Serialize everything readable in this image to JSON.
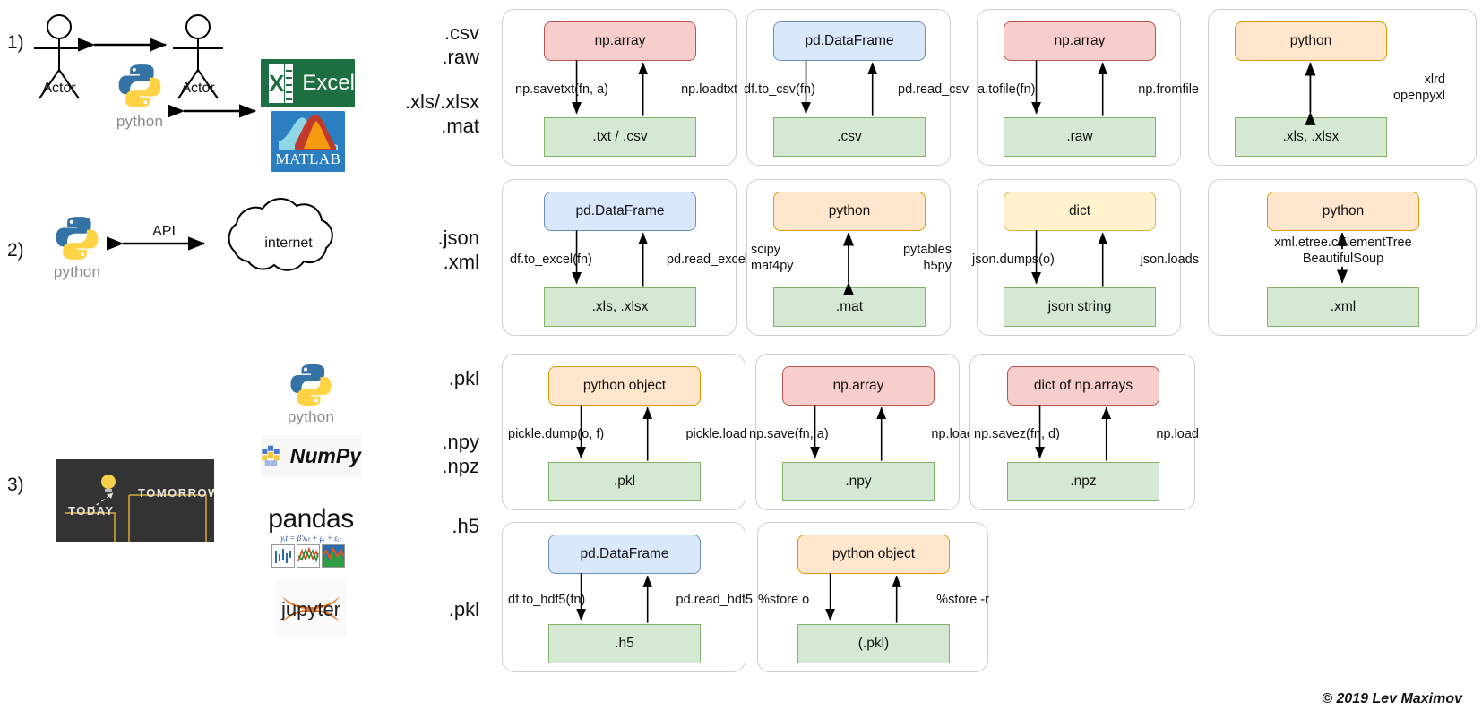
{
  "rows": [
    {
      "number": "1)"
    },
    {
      "number": "2)"
    },
    {
      "number": "3)"
    }
  ],
  "illustrations": {
    "actor_left_label": "Actor",
    "actor_right_label": "Actor",
    "python_label_1": "python",
    "python_label_2": "python",
    "python_label_3": "python",
    "excel_label": "Excel",
    "excel_x": "X",
    "matlab_label": "MATLAB",
    "api_label": "API",
    "internet_label": "internet",
    "numpy_label": "NumPy",
    "pandas_label": "pandas",
    "pandas_formula": "yᵢt = β'xᵢₜ + μᵢ + εᵢₜ",
    "jupyter_label": "jupyter",
    "chalkboard_today": "TODAY",
    "chalkboard_tomorrow": "TOMORROW"
  },
  "extensions": [
    {
      "text": ".csv\n.raw"
    },
    {
      "text": ".xls/.xlsx\n.mat"
    },
    {
      "text": ".json\n.xml"
    },
    {
      "text": ".pkl"
    },
    {
      "text": ".npy\n.npz"
    },
    {
      "text": ".h5"
    },
    {
      "text": ".pkl"
    }
  ],
  "colors": {
    "red_fill": "#f8cecc",
    "red_border": "#b85450",
    "blue_fill": "#dae8fc",
    "blue_border": "#6c8ebf",
    "orange_fill": "#ffe6cc",
    "orange_border": "#d79b00",
    "yellow_fill": "#fff2cc",
    "yellow_border": "#d6b656",
    "green_fill": "#d5e8d4",
    "green_border": "#82b366",
    "card_border": "#cfcfcf"
  },
  "cards": [
    {
      "id": "csv-numpy",
      "top": {
        "label": "np.array",
        "style": "red"
      },
      "bottom": {
        "label": ".txt / .csv",
        "style": "green"
      },
      "left_label": "np.savetxt(fn, a)",
      "right_label": "np.loadtxt",
      "arrows": "both"
    },
    {
      "id": "csv-pandas",
      "top": {
        "label": "pd.DataFrame",
        "style": "blue"
      },
      "bottom": {
        "label": ".csv",
        "style": "green"
      },
      "left_label": "df.to_csv(fn)",
      "right_label": "pd.read_csv",
      "arrows": "both"
    },
    {
      "id": "raw-numpy",
      "top": {
        "label": "np.array",
        "style": "red"
      },
      "bottom": {
        "label": ".raw",
        "style": "green"
      },
      "left_label": "a.tofile(fn)",
      "right_label": "np.fromfile",
      "arrows": "both"
    },
    {
      "id": "xls-python",
      "top": {
        "label": "python",
        "style": "orange"
      },
      "bottom": {
        "label": ".xls, .xlsx",
        "style": "green"
      },
      "right_label": "xlrd\nopenpyxl",
      "arrows": "double"
    },
    {
      "id": "xls-pandas",
      "top": {
        "label": "pd.DataFrame",
        "style": "blue"
      },
      "bottom": {
        "label": ".xls, .xlsx",
        "style": "green"
      },
      "left_label": "df.to_excel(fn)",
      "right_label": "pd.read_excel",
      "arrows": "both"
    },
    {
      "id": "mat-python",
      "top": {
        "label": "python",
        "style": "orange"
      },
      "bottom": {
        "label": ".mat",
        "style": "green"
      },
      "left_label": "scipy\nmat4py",
      "right_label": "pytables\nh5py",
      "arrows": "double"
    },
    {
      "id": "json-dict",
      "top": {
        "label": "dict",
        "style": "yellow"
      },
      "bottom": {
        "label": "json string",
        "style": "green"
      },
      "left_label": "json.dumps(o)",
      "right_label": "json.loads",
      "arrows": "both"
    },
    {
      "id": "xml-python",
      "top": {
        "label": "python",
        "style": "orange"
      },
      "bottom": {
        "label": ".xml",
        "style": "green"
      },
      "center_label": "xml.etree.cElementTree\nBeautifulSoup",
      "arrows": "double-center"
    },
    {
      "id": "pkl-python",
      "top": {
        "label": "python object",
        "style": "orange"
      },
      "bottom": {
        "label": ".pkl",
        "style": "green"
      },
      "left_label": "pickle.dump(o, f)",
      "right_label": "pickle.load",
      "arrows": "both"
    },
    {
      "id": "npy-numpy",
      "top": {
        "label": "np.array",
        "style": "red"
      },
      "bottom": {
        "label": ".npy",
        "style": "green"
      },
      "left_label": "np.save(fn, a)",
      "right_label": "np.load",
      "arrows": "both"
    },
    {
      "id": "npz-numpy",
      "top": {
        "label": "dict of np.arrays",
        "style": "red"
      },
      "bottom": {
        "label": ".npz",
        "style": "green"
      },
      "left_label": "np.savez(fn, d)",
      "right_label": "np.load",
      "arrows": "both"
    },
    {
      "id": "h5-pandas",
      "top": {
        "label": "pd.DataFrame",
        "style": "blue"
      },
      "bottom": {
        "label": ".h5",
        "style": "green"
      },
      "left_label": "df.to_hdf5(fn)",
      "right_label": "pd.read_hdf5",
      "arrows": "both"
    },
    {
      "id": "pkl-jupyter",
      "top": {
        "label": "python object",
        "style": "orange"
      },
      "bottom": {
        "label": "(.pkl)",
        "style": "green"
      },
      "left_label": "%store o",
      "right_label": "%store -r",
      "arrows": "both"
    }
  ],
  "footer": {
    "copyright": "© 2019 Lev Maximov"
  }
}
